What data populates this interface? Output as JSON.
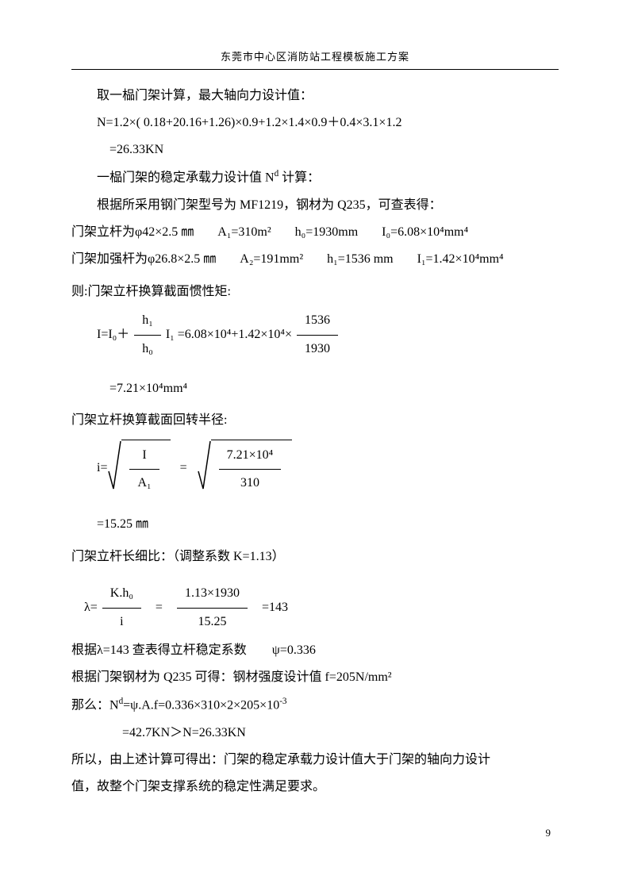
{
  "header": "东莞市中心区消防站工程模板施工方案",
  "p1": "取一榀门架计算，最大轴向力设计值：",
  "p2": "N=1.2×( 0.18+20.16+1.26)×0.9+1.2×1.4×0.9＋0.4×3.1×1.2",
  "p3": "=26.33KN",
  "p4_a": "一榀门架的稳定承载力设计值 N",
  "p4_b": "d",
  "p4_c": " 计算：",
  "p5": "根据所采用钢门架型号为 MF1219，钢材为 Q235，可查表得：",
  "p6_label": "门架立杆为φ42×2.5 ㎜",
  "p6_A": "A₁=310m²",
  "p6_h": "h₀=1930mm",
  "p6_I": "I₀=6.08×10⁴mm⁴",
  "p7_label": "门架加强杆为φ26.8×2.5 ㎜",
  "p7_A": "A₂=191mm²",
  "p7_h": "h₁=1536 mm",
  "p7_I": "I₁=1.42×10⁴mm⁴",
  "p8": "则:门架立杆换算截面惯性矩:",
  "eq1_left": "I=I₀＋",
  "eq1_num1": "h₁",
  "eq1_den1": "h₀",
  "eq1_mid": "I₁ =6.08×10⁴+1.42×10⁴×",
  "eq1_num2": "1536",
  "eq1_den2": "1930",
  "p9": "=7.21×10⁴mm⁴",
  "p10": "门架立杆换算截面回转半径:",
  "eq2_ieq": "i=",
  "eq2_num1": "I",
  "eq2_den1": "A₁",
  "eq2_eq": "=",
  "eq2_num2": "7.21×10⁴",
  "eq2_den2": "310",
  "p11": "=15.25 ㎜",
  "p12": "门架立杆长细比：（调整系数 K=1.13）",
  "eq3_lam": "λ=",
  "eq3_num1": "K.h₀",
  "eq3_den1": "i",
  "eq3_eq1": "=",
  "eq3_num2": "1.13×1930",
  "eq3_den2": "15.25",
  "eq3_eq2": "=143",
  "p13": "根据λ=143 查表得立杆稳定系数　　ψ=0.336",
  "p14": "根据门架钢材为 Q235 可得：钢材强度设计值 f=205N/mm²",
  "p15_a": "那么：N",
  "p15_b": "d",
  "p15_c": "=ψ.A.f=0.336×310×2×205×10",
  "p15_d": "-3",
  "p16": "=42.7KN＞N=26.33KN",
  "p17": "所以，由上述计算可得出：门架的稳定承载力设计值大于门架的轴向力设计",
  "p18": "值，故整个门架支撑系统的稳定性满足要求。",
  "page_num": "9"
}
